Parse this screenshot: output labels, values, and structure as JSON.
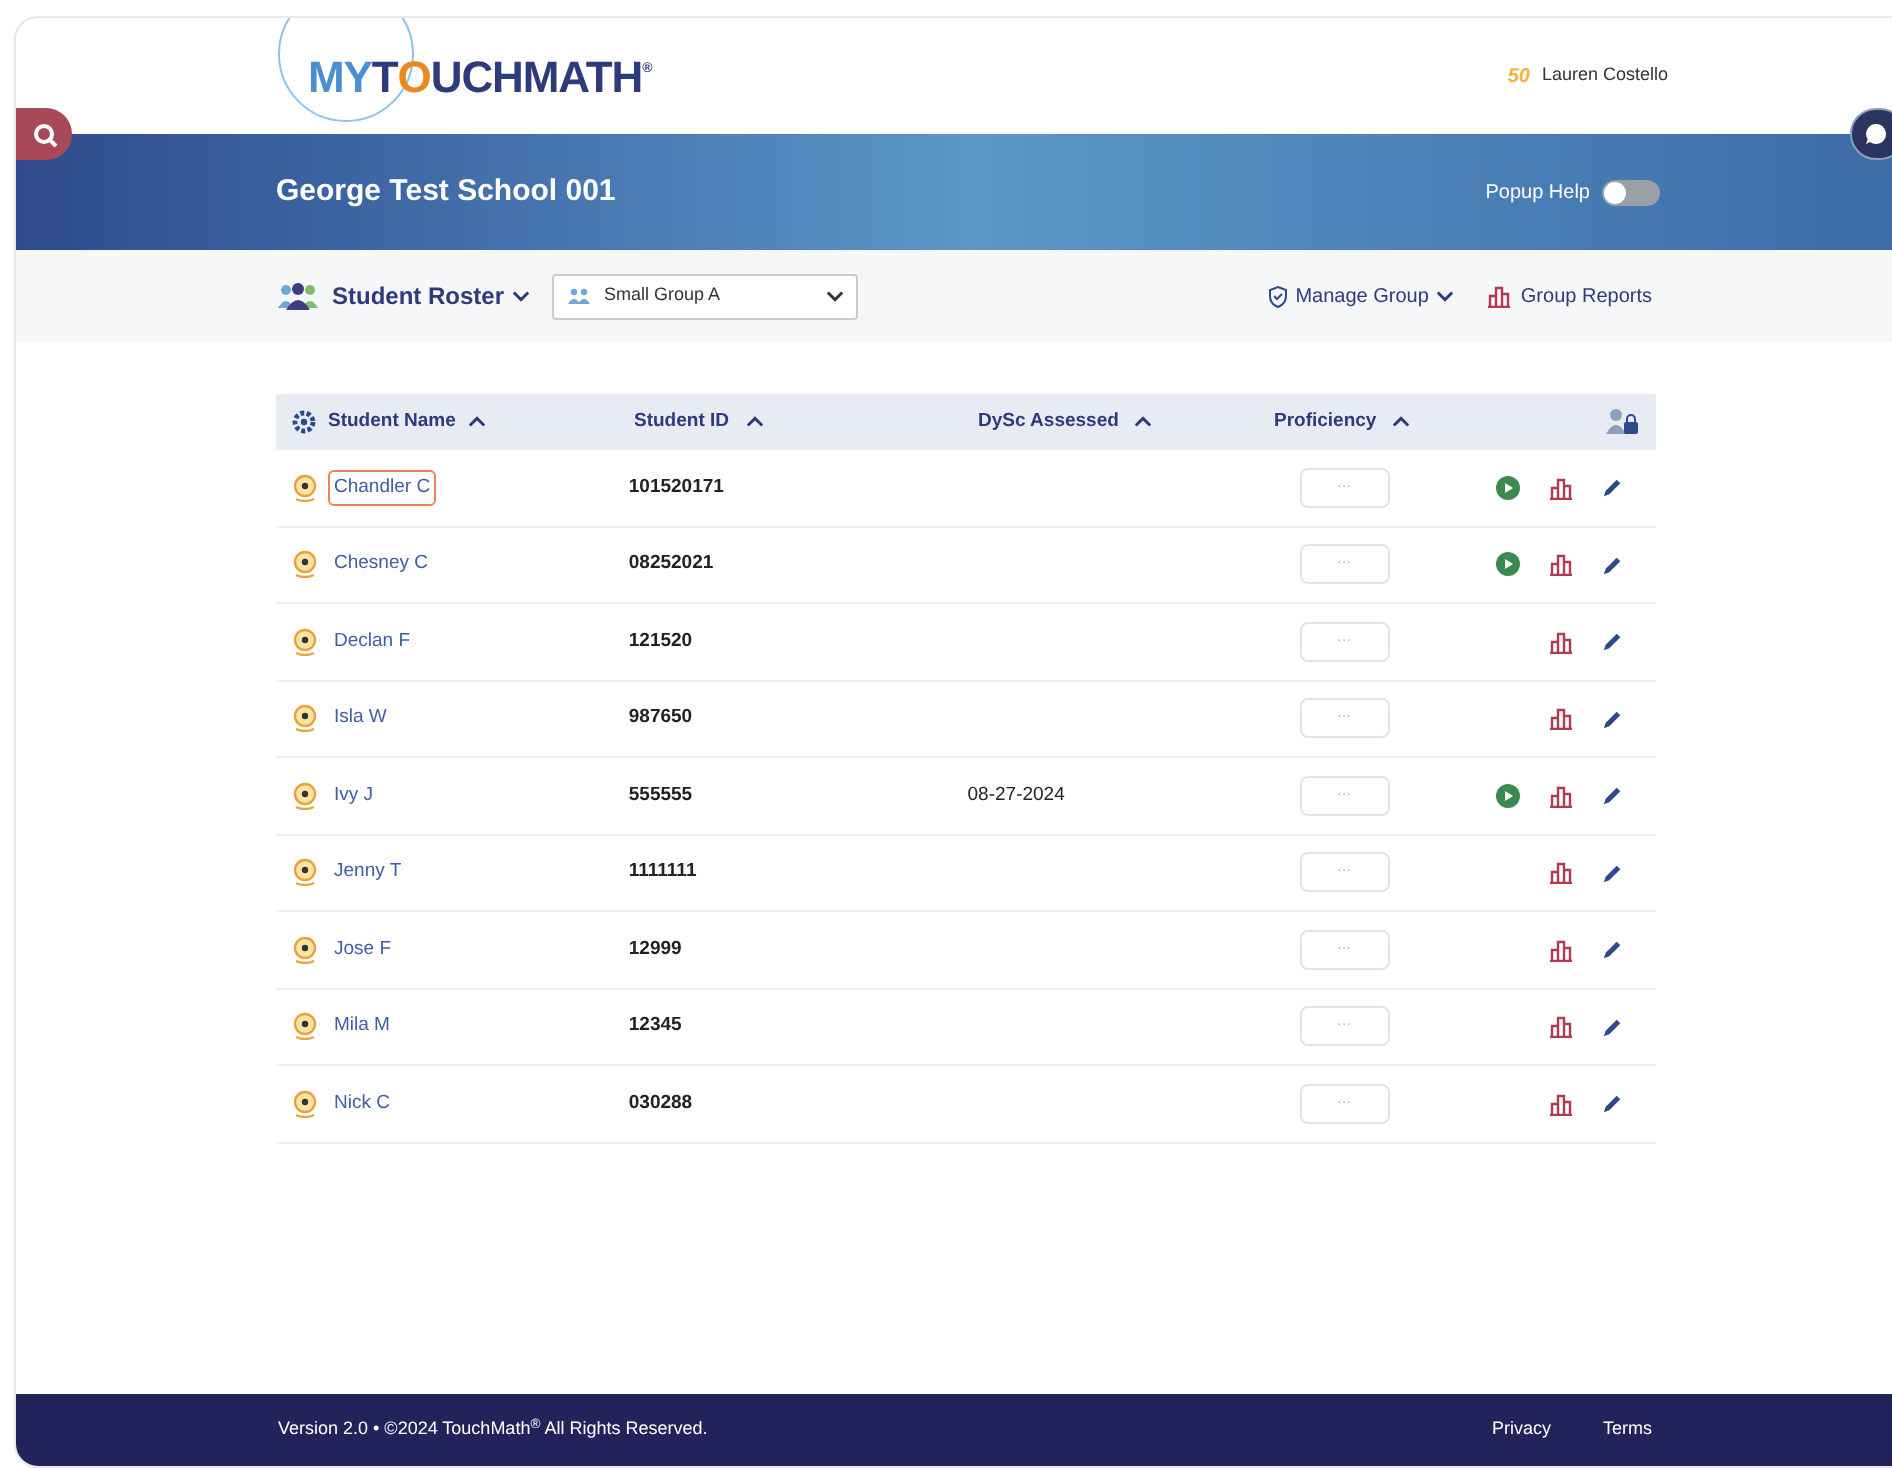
{
  "header": {
    "logo": {
      "part_1": "MY",
      "part_2": "T",
      "part_3": "O",
      "part_4": "UCHMATH",
      "mark": "®"
    },
    "badge": "50",
    "user": "Lauren Costello"
  },
  "banner": {
    "school": "George Test School 001",
    "popup_help": {
      "label": "Popup Help",
      "on": false
    }
  },
  "toolbar": {
    "roster": "Student Roster",
    "group_select": "Small Group A",
    "manage_group": "Manage Group",
    "group_reports": "Group Reports"
  },
  "table": {
    "columns": [
      "Student Name",
      "Student ID",
      "DySc Assessed",
      "Proficiency"
    ],
    "rows": [
      {
        "name": "Chandler C",
        "focused": true,
        "id": "101520171",
        "proficiency": "···",
        "play": true
      },
      {
        "name": "Chesney C",
        "focused": false,
        "id": "08252021",
        "proficiency": "···",
        "play": true
      },
      {
        "name": "Declan F",
        "focused": false,
        "id": "121520",
        "proficiency": "···",
        "play": false
      },
      {
        "name": "Isla W",
        "focused": false,
        "id": "987650",
        "proficiency": "···",
        "play": false
      },
      {
        "name": "Ivy J",
        "focused": false,
        "id": "555555",
        "assessed": "08-27-2024",
        "proficiency": "···",
        "play": true
      },
      {
        "name": "Jenny T",
        "focused": false,
        "id": "1111111",
        "proficiency": "···",
        "play": false
      },
      {
        "name": "Jose F",
        "focused": false,
        "id": "12999",
        "proficiency": "···",
        "play": false
      },
      {
        "name": "Mila M",
        "focused": false,
        "id": "12345",
        "proficiency": "···",
        "play": false
      },
      {
        "name": "Nick C",
        "focused": false,
        "id": "030288",
        "proficiency": "···",
        "play": false
      }
    ]
  },
  "footer": {
    "copyright": "Version 2.0 • ©2024 TouchMath$^{®}$ All Rights Reserved.",
    "links": [
      "Privacy",
      "Terms"
    ]
  }
}
